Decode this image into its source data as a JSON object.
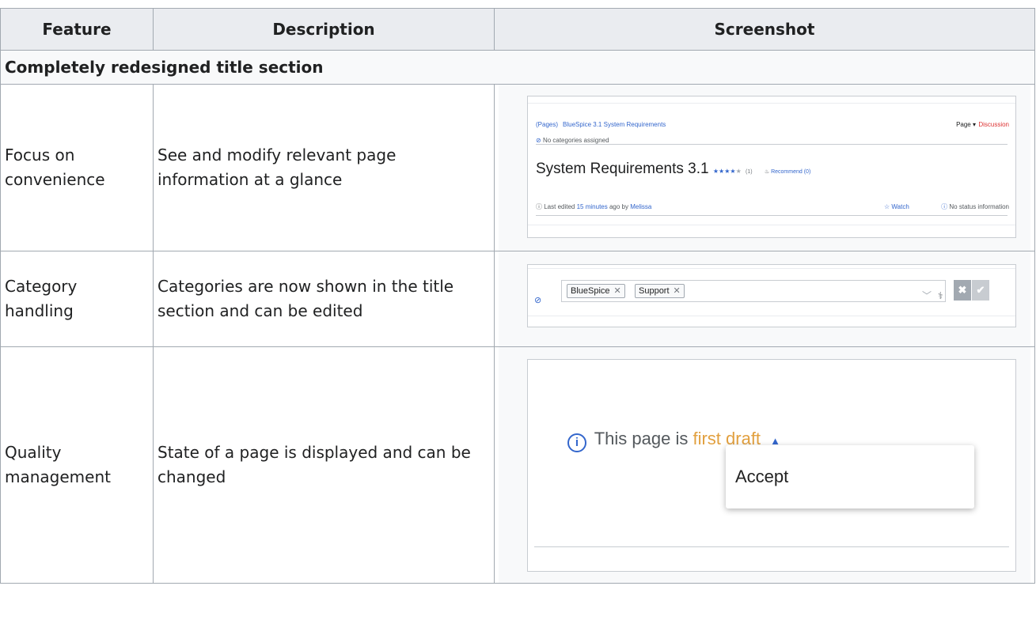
{
  "table": {
    "headers": [
      "Feature",
      "Description",
      "Screenshot"
    ],
    "section_title": "Completely redesigned title section",
    "rows": [
      {
        "feature": "Focus on convenience",
        "description": "See and modify relevant page information at a glance"
      },
      {
        "feature": "Category handling",
        "description": "Categories are now shown in the title section and can be edited"
      },
      {
        "feature": "Quality management",
        "description": "State of a page is displayed and can be changed"
      }
    ]
  },
  "shot1": {
    "breadcrumb_ns": "(Pages)",
    "breadcrumb_page": "BlueSpice 3.1 System Requirements",
    "page_menu": "Page",
    "discussion": "Discussion",
    "no_categories": "No categories assigned",
    "title": "System Requirements 3.1",
    "rating_count": "(1)",
    "recommend": "Recommend (0)",
    "last_edited_prefix": "Last edited",
    "last_edited_time": "15 minutes",
    "last_edited_mid": "ago by",
    "last_edited_user": "Melissa",
    "watch": "Watch",
    "no_status": "No status information"
  },
  "shot2": {
    "chips": [
      "BlueSpice",
      "Support"
    ]
  },
  "shot3": {
    "state_prefix": "This page is",
    "state_value": "first draft",
    "menu_item": "Accept"
  },
  "colors": {
    "link": "#3366cc",
    "draft": "#e2a03f",
    "discussion": "#dd3333"
  }
}
